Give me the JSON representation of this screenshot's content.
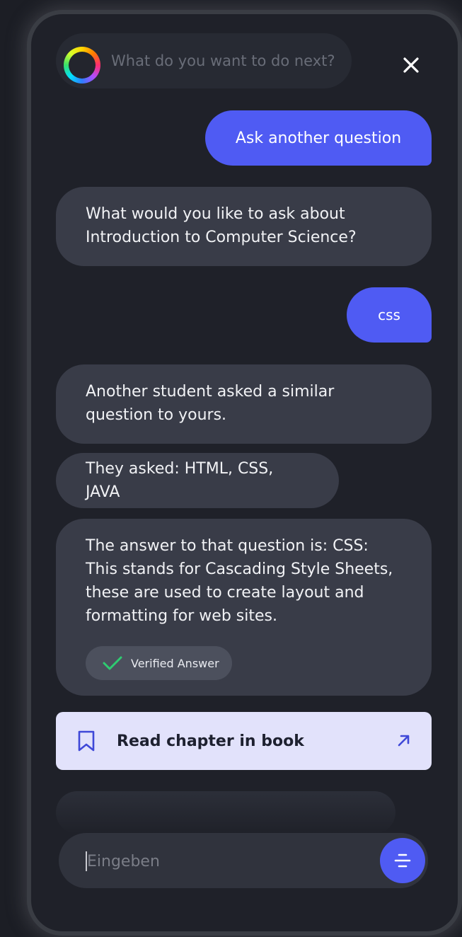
{
  "header": {
    "prompt_placeholder": "What do you want to do next?",
    "logo_icon": "rainbow-ring-icon",
    "close_icon": "close-icon"
  },
  "conversation": {
    "messages": [
      {
        "role": "user",
        "text": "Ask another question"
      },
      {
        "role": "assistant",
        "text": "What would you like to ask about Introduction to Computer Science?"
      },
      {
        "role": "user",
        "text": "css"
      },
      {
        "role": "assistant",
        "text": "Another student asked a similar question to yours."
      },
      {
        "role": "assistant",
        "text": "They asked: HTML, CSS, JAVA"
      },
      {
        "role": "assistant",
        "text": "The answer to that question is: CSS: This stands for Cascading Style Sheets, these are used to create layout and formatting for web sites."
      }
    ],
    "verified_badge": "Verified Answer"
  },
  "book_link": {
    "label": "Read chapter in book",
    "icon": "bookmark-icon",
    "arrow_icon": "arrow-up-right-icon"
  },
  "composer": {
    "placeholder": "Eingeben",
    "menu_icon": "menu-lines-icon"
  },
  "colors": {
    "accent": "#4f5bf3",
    "panel_bg": "#1f2129",
    "bot_bubble": "#393c48",
    "book_card": "#e2e2fb",
    "verified_check": "#2ecc71"
  }
}
